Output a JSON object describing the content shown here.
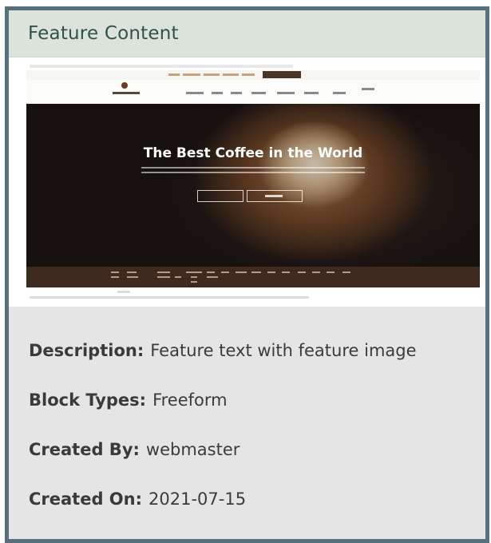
{
  "card": {
    "title": "Feature Content",
    "thumbnail": {
      "hero_title": "The Best Coffee in the World"
    },
    "description_label": "Description:",
    "description_value": "Feature text with feature image",
    "block_types_label": "Block Types:",
    "block_types_value": "Freeform",
    "created_by_label": "Created By:",
    "created_by_value": "webmaster",
    "created_on_label": "Created On:",
    "created_on_value": "2021-07-15"
  },
  "colors": {
    "card_border": "#56707d",
    "header_bg": "#dbe3da",
    "title_color": "#2f5446",
    "body_bg": "#e5e5e5"
  }
}
